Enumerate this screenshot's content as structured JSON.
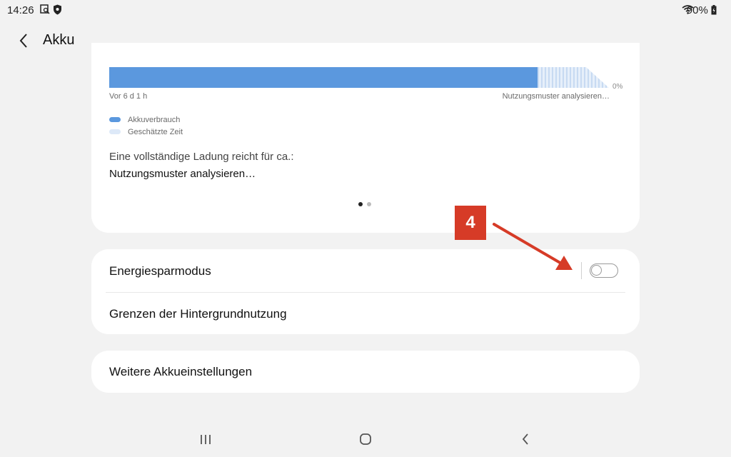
{
  "status": {
    "time": "14:26",
    "battery": "90%"
  },
  "header": {
    "title": "Akku"
  },
  "usage_card": {
    "percent_label": "0%",
    "axis_left": "Vor 6 d 1 h",
    "axis_right": "Nutzungsmuster analysieren…",
    "legend": [
      {
        "label": "Akkuverbrauch",
        "color": "#5b98de"
      },
      {
        "label": "Geschätzte Zeit",
        "color": "#dde9f8"
      }
    ],
    "full_charge_label": "Eine vollständige Ladung reicht für ca.:",
    "full_charge_value": "Nutzungsmuster analysieren…"
  },
  "settings": {
    "power_saving_label": "Energiesparmodus",
    "power_saving_enabled": false,
    "background_limits_label": "Grenzen der Hintergrundnutzung"
  },
  "more": {
    "label": "Weitere Akkueinstellungen"
  },
  "annotation": {
    "badge": "4",
    "color": "#d63b27"
  },
  "icons": [
    "screenshot-icon",
    "shield-icon",
    "wifi-icon",
    "battery-icon",
    "back-icon",
    "recents-icon",
    "home-icon",
    "nav-back-icon"
  ]
}
